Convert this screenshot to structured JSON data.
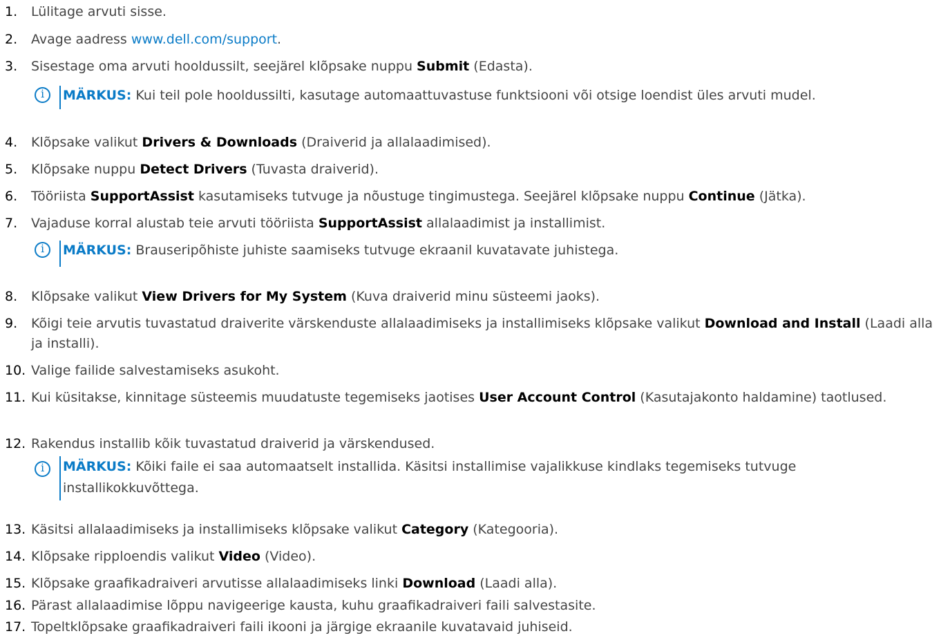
{
  "steps": [
    {
      "num": "1.",
      "parts": [
        {
          "t": "Lülitage arvuti sisse."
        }
      ]
    },
    {
      "num": "2.",
      "parts": [
        {
          "t": "Avage aadress "
        },
        {
          "t": "www.dell.com/support",
          "link": true
        },
        {
          "t": "."
        }
      ]
    },
    {
      "num": "3.",
      "parts": [
        {
          "t": "Sisestage oma arvuti hooldussilt, seejärel klõpsake nuppu "
        },
        {
          "t": "Submit",
          "b": true
        },
        {
          "t": " (Edasta)."
        }
      ]
    },
    {
      "num": "4.",
      "parts": [
        {
          "t": "Klõpsake valikut "
        },
        {
          "t": "Drivers & Downloads",
          "b": true
        },
        {
          "t": " (Draiverid ja allalaadimised)."
        }
      ]
    },
    {
      "num": "5.",
      "parts": [
        {
          "t": "Klõpsake nuppu "
        },
        {
          "t": "Detect Drivers",
          "b": true
        },
        {
          "t": " (Tuvasta draiverid)."
        }
      ]
    },
    {
      "num": "6.",
      "parts": [
        {
          "t": "Tööriista "
        },
        {
          "t": "SupportAssist",
          "b": true
        },
        {
          "t": " kasutamiseks tutvuge ja nõustuge tingimustega. Seejärel klõpsake nuppu "
        },
        {
          "t": "Continue",
          "b": true
        },
        {
          "t": " (Jätka)."
        }
      ]
    },
    {
      "num": "7.",
      "parts": [
        {
          "t": "Vajaduse korral alustab teie arvuti tööriista "
        },
        {
          "t": "SupportAssist",
          "b": true
        },
        {
          "t": " allalaadimist ja installimist."
        }
      ]
    },
    {
      "num": "8.",
      "parts": [
        {
          "t": "Klõpsake valikut "
        },
        {
          "t": "View Drivers for My System",
          "b": true
        },
        {
          "t": " (Kuva draiverid minu süsteemi jaoks)."
        }
      ]
    },
    {
      "num": "9.",
      "parts": [
        {
          "t": "Kõigi teie arvutis tuvastatud draiverite värskenduste allalaadimiseks ja installimiseks klõpsake valikut "
        },
        {
          "t": "Download and Install",
          "b": true
        },
        {
          "t": " (Laadi alla ja installi)."
        }
      ]
    },
    {
      "num": "10.",
      "parts": [
        {
          "t": "Valige failide salvestamiseks asukoht."
        }
      ]
    },
    {
      "num": "11.",
      "parts": [
        {
          "t": "Kui küsitakse, kinnitage süsteemis muudatuste tegemiseks jaotises "
        },
        {
          "t": "User Account Control",
          "b": true
        },
        {
          "t": " (Kasutajakonto haldamine) taotlused."
        }
      ]
    },
    {
      "num": "12.",
      "parts": [
        {
          "t": "Rakendus installib kõik tuvastatud draiverid ja värskendused."
        }
      ]
    },
    {
      "num": "13.",
      "parts": [
        {
          "t": "Käsitsi allalaadimiseks ja installimiseks klõpsake valikut "
        },
        {
          "t": "Category",
          "b": true
        },
        {
          "t": " (Kategooria)."
        }
      ]
    },
    {
      "num": "14.",
      "parts": [
        {
          "t": "Klõpsake ripploendis valikut "
        },
        {
          "t": "Video",
          "b": true
        },
        {
          "t": " (Video)."
        }
      ]
    },
    {
      "num": "15.",
      "parts": [
        {
          "t": "Klõpsake graafikadraiveri arvutisse allalaadimiseks linki "
        },
        {
          "t": "Download",
          "b": true
        },
        {
          "t": " (Laadi alla)."
        }
      ]
    },
    {
      "num": "16.",
      "parts": [
        {
          "t": "Pärast allalaadimise lõppu navigeerige kausta, kuhu graafikadraiveri faili salvestasite."
        }
      ]
    },
    {
      "num": "17.",
      "parts": [
        {
          "t": "Topeltklõpsake graafikadraiveri faili ikooni ja järgige ekraanile kuvatavaid juhiseid."
        }
      ]
    }
  ],
  "notes": [
    {
      "label": "MÄRKUS:",
      "text": " Kui teil pole hooldussilti, kasutage automaattuvastuse funktsiooni või otsige loendist üles arvuti mudel."
    },
    {
      "label": "MÄRKUS:",
      "text": " Brauseripõhiste juhiste saamiseks tutvuge ekraanil kuvatavate juhistega."
    },
    {
      "label": "MÄRKUS:",
      "text": " Kõiki faile ei saa automaatselt installida. Käsitsi installimise vajalikkuse kindlaks tegemiseks tutvuge installikokkuvõttega."
    }
  ],
  "colors": {
    "accent": "#0a7bc7",
    "text": "#444444",
    "number": "#000000"
  },
  "icons": {
    "note": "info-circle-icon"
  }
}
